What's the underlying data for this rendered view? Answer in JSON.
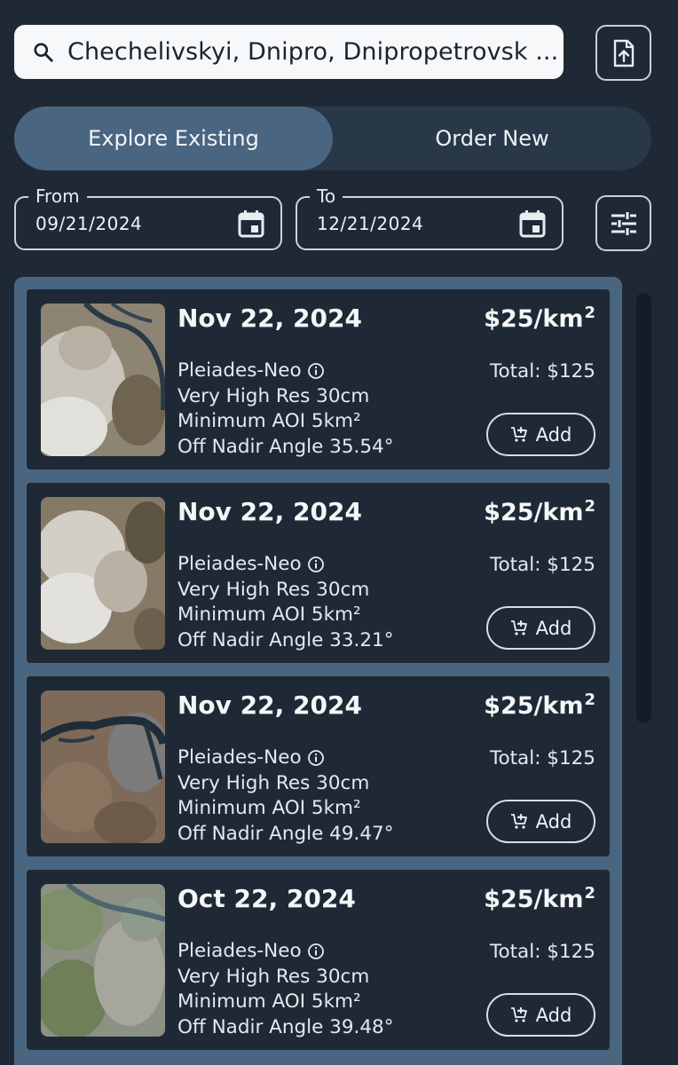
{
  "search": {
    "value": "Chechelivskyi, Dnipro, Dnipropetrovsk ..."
  },
  "tabs": [
    {
      "label": "Explore Existing",
      "active": true
    },
    {
      "label": "Order New",
      "active": false
    }
  ],
  "dates": {
    "from_label": "From",
    "from_value": "09/21/2024",
    "to_label": "To",
    "to_value": "12/21/2024"
  },
  "results": [
    {
      "date": "Nov 22, 2024",
      "sensor": "Pleiades-Neo",
      "resolution": "Very High Res 30cm",
      "aoi": "Minimum AOI 5km²",
      "angle": "Off Nadir Angle 35.54°",
      "price": "$25/km",
      "price_unit_sup": "2",
      "total": "Total: $125",
      "add_label": "Add"
    },
    {
      "date": "Nov 22, 2024",
      "sensor": "Pleiades-Neo",
      "resolution": "Very High Res 30cm",
      "aoi": "Minimum AOI 5km²",
      "angle": "Off Nadir Angle 33.21°",
      "price": "$25/km",
      "price_unit_sup": "2",
      "total": "Total: $125",
      "add_label": "Add"
    },
    {
      "date": "Nov 22, 2024",
      "sensor": "Pleiades-Neo",
      "resolution": "Very High Res 30cm",
      "aoi": "Minimum AOI 5km²",
      "angle": "Off Nadir Angle 49.47°",
      "price": "$25/km",
      "price_unit_sup": "2",
      "total": "Total: $125",
      "add_label": "Add"
    },
    {
      "date": "Oct 22, 2024",
      "sensor": "Pleiades-Neo",
      "resolution": "Very High Res 30cm",
      "aoi": "Minimum AOI 5km²",
      "angle": "Off Nadir Angle 39.48°",
      "price": "$25/km",
      "price_unit_sup": "2",
      "total": "Total: $125",
      "add_label": "Add"
    }
  ],
  "icons": {
    "search": "search-icon",
    "upload": "upload-file-icon",
    "calendar": "calendar-icon",
    "filter": "filter-sliders-icon",
    "info": "info-icon",
    "cart": "add-cart-icon"
  },
  "colors": {
    "background": "#1f2935",
    "accent": "#4a6580",
    "tab_track": "#293848",
    "search_bg": "#f6f8fa"
  }
}
